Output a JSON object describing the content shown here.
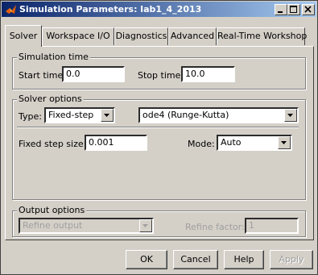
{
  "window": {
    "title": "Simulation Parameters: lab1_4_2013"
  },
  "tabs": [
    {
      "label": "Solver"
    },
    {
      "label": "Workspace I/O"
    },
    {
      "label": "Diagnostics"
    },
    {
      "label": "Advanced"
    },
    {
      "label": "Real-Time Workshop"
    }
  ],
  "simulation_time": {
    "group_label": "Simulation time",
    "start_label": "Start time:",
    "start_value": "0.0",
    "stop_label": "Stop time:",
    "stop_value": "10.0"
  },
  "solver_options": {
    "group_label": "Solver options",
    "type_label": "Type:",
    "type_value": "Fixed-step",
    "solver_value": "ode4 (Runge-Kutta)",
    "step_label": "Fixed step size:",
    "step_value": "0.001",
    "mode_label": "Mode:",
    "mode_value": "Auto"
  },
  "output_options": {
    "group_label": "Output options",
    "refine_value": "Refine output",
    "factor_label": "Refine factor:",
    "factor_value": "1"
  },
  "buttons": {
    "ok": "OK",
    "cancel": "Cancel",
    "help": "Help",
    "apply": "Apply"
  },
  "colors": {
    "titlebar_start": "#0a246a",
    "titlebar_end": "#a6caf0",
    "face": "#d4d0c8"
  }
}
